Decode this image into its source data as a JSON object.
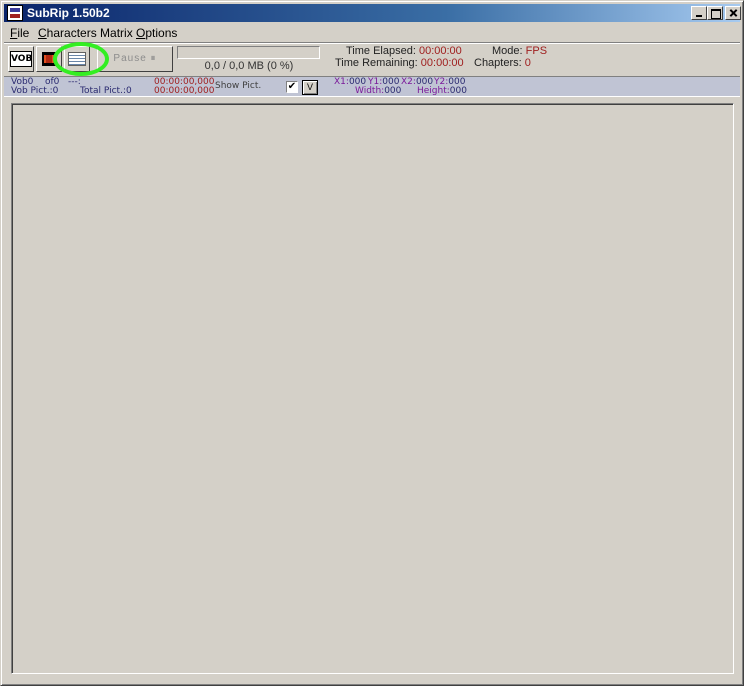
{
  "window": {
    "title": "SubRip 1.50b2"
  },
  "menu": [
    {
      "underline": "F",
      "rest": "ile"
    },
    {
      "underline": "C",
      "rest": "haracters Matrix"
    },
    {
      "underline": "O",
      "rest": "ptions"
    }
  ],
  "toolbar": {
    "vob_icon_text": "VOB",
    "pause_label": "Pause ⏸",
    "progress_fraction": 0,
    "progress_text": "0,0 / 0,0 MB (0 %)",
    "time_elapsed_label": "Time Elapsed:",
    "time_elapsed_value": "00:00:00",
    "time_remaining_label": "Time Remaining:",
    "time_remaining_value": "00:00:00",
    "mode_label": "Mode:",
    "mode_value": "FPS",
    "chapters_label": "Chapters:",
    "chapters_value": "0"
  },
  "info": {
    "vob_label": "Vob0",
    "of_label": "of0",
    "dashes": "---:",
    "vob_pict": "Vob Pict.:0",
    "total_pict": "Total Pict.:0",
    "time_start": "00:00:00,000",
    "time_end": "00:00:00,000",
    "show_pict_label": "Show Pict.",
    "show_pict_checked": "✔",
    "v_button": "V",
    "x1_label": "X1:",
    "x1_value": "000",
    "y1_label": "Y1:",
    "y1_value": "000",
    "x2_label": "X2:",
    "x2_value": "000",
    "y2_label": "Y2:",
    "y2_value": "000",
    "width_label": "Width:",
    "width_value": "000",
    "height_label": "Height:",
    "height_value": "000"
  },
  "icons": {
    "app": "subrip-app-icon",
    "vob": "open-vob-icon",
    "film": "film-icon",
    "matrix": "characters-matrix-icon"
  },
  "colors": {
    "highlight": "#33ee22",
    "value_red": "#a02020",
    "value_purple": "#7a1a9a"
  }
}
